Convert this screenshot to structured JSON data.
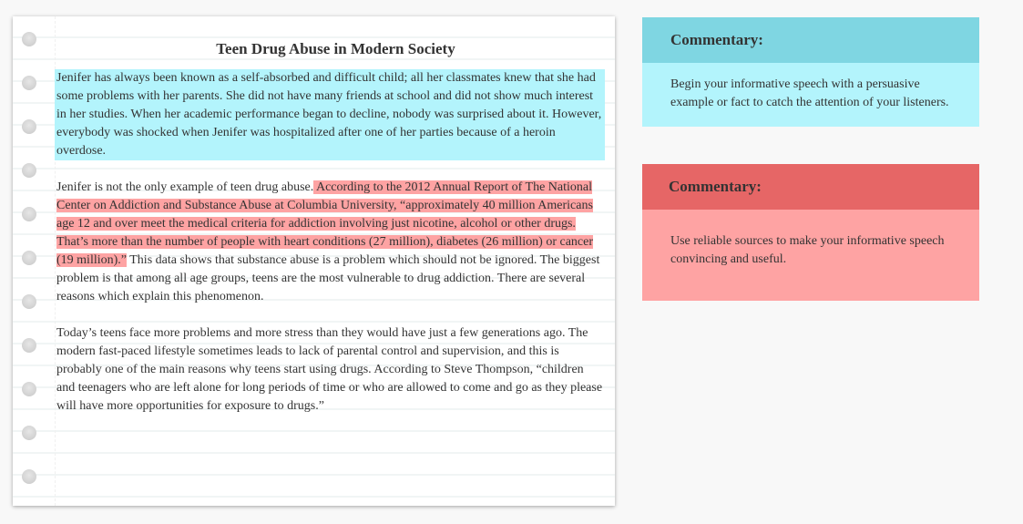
{
  "document": {
    "title": "Teen Drug Abuse in Modern Society",
    "paragraphs": [
      {
        "highlighted_all": "Jenifer has always been known as a self-absorbed and difficult child; all her classmates knew that she had some problems with her parents. She did not have many friends at school and did not show much interest in her studies. When her academic performance began to decline, nobody was surprised about it. However, everybody was shocked when Jenifer was hospitalized after one of her parties because of a heroin overdose.",
        "highlight_color": "#b3f4fc"
      },
      {
        "before": "Jenifer is not the only example of teen drug abuse.",
        "highlighted": " According to the 2012 Annual Report of The National Center on Addiction and Substance Abuse at Columbia University, “approximately 40 million Americans age 12 and over meet the medical criteria for addiction involving just nicotine, alcohol or other drugs. That’s more than the number of people with heart conditions (27 million), diabetes (26 million) or cancer (19 million).”",
        "after": " This data shows that substance abuse is a problem which should not be ignored. The biggest problem is that among all age groups, teens are the most vulnerable to drug addiction. There are several reasons which explain this phenomenon.",
        "highlight_color": "#fea3a3"
      },
      {
        "text": "Today’s teens face more problems and more stress than they would have just a few generations ago. The modern fast-paced lifestyle sometimes leads to lack of parental control and supervision, and this is probably one of the main reasons why teens start using drugs. According to Steve Thompson, “children and teenagers who are left alone for long periods of time or who are allowed to come and go as they please will have more opportunities for exposure to drugs.”"
      }
    ]
  },
  "commentaries": [
    {
      "heading": "Commentary:",
      "text": "Begin your informative speech with a persuasive example or fact to catch the attention of your listeners.",
      "header_color": "#7fd6e2",
      "body_color": "#b3f4fc"
    },
    {
      "heading": "Commentary:",
      "text": "Use reliable sources to make your informative speech convincing and useful.",
      "header_color": "#e66666",
      "body_color": "#fea3a3"
    }
  ]
}
